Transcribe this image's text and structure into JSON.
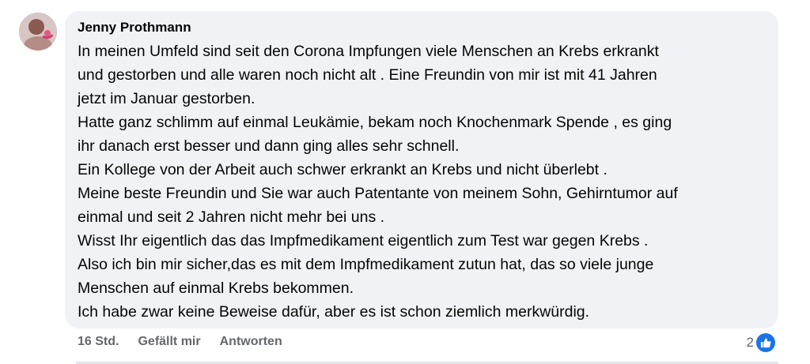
{
  "comment": {
    "author": "Jenny Prothmann",
    "lines": [
      "In meinen Umfeld sind seit den Corona Impfungen viele Menschen an Krebs erkrankt",
      "und gestorben und alle waren noch nicht alt . Eine Freundin von mir ist mit 41 Jahren",
      "jetzt im Januar gestorben.",
      "Hatte ganz schlimm auf einmal Leukämie, bekam noch Knochenmark Spende , es ging",
      "ihr danach erst besser und dann ging alles sehr schnell.",
      "Ein Kollege von der Arbeit auch schwer erkrankt an Krebs und nicht überlebt .",
      "Meine beste Freundin und Sie war auch Patentante von meinem Sohn, Gehirntumor auf",
      "einmal und seit 2 Jahren nicht mehr bei uns .",
      "Wisst Ihr eigentlich das das Impfmedikament eigentlich zum Test war gegen Krebs .",
      "Also ich bin mir sicher,das es mit dem Impfmedikament zutun hat, das so viele junge",
      "Menschen auf einmal Krebs bekommen.",
      "Ich habe zwar keine Beweise dafür, aber es ist schon ziemlich merkwürdig."
    ]
  },
  "meta": {
    "timestamp": "16 Std.",
    "like_label": "Gefällt mir",
    "reply_label": "Antworten"
  },
  "reactions": {
    "count": "2",
    "icon": "thumbs-up-icon",
    "color": "#1b74e4"
  },
  "colors": {
    "bubble": "#f0f2f5",
    "text": "#050505",
    "secondary_text": "#65676b"
  }
}
